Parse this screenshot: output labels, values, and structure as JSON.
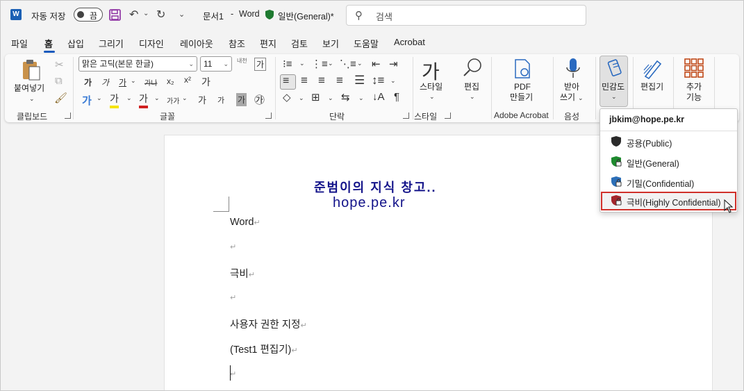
{
  "titlebar": {
    "app_letter": "W",
    "autosave_label": "자동 저장",
    "autosave_state": "끔",
    "doc_name": "문서1",
    "sep": "-",
    "app_name": "Word",
    "label_status": "일반(General)*",
    "search_placeholder": "검색"
  },
  "menu": {
    "items": [
      "파일",
      "홈",
      "삽입",
      "그리기",
      "디자인",
      "레이아웃",
      "참조",
      "편지",
      "검토",
      "보기",
      "도움말",
      "Acrobat"
    ],
    "active": "홈"
  },
  "ribbon": {
    "clipboard": {
      "paste": "붙여넣기",
      "group": "클립보드"
    },
    "font": {
      "name": "맑은 고딕(본문 한글)",
      "size": "11",
      "group": "글꼴",
      "bold": "가",
      "italic": "가",
      "underline": "가",
      "strike": "가나",
      "sub": "x₂",
      "sup": "x²",
      "clear": "가",
      "grow": "가",
      "shrink": "가",
      "case": "가가",
      "charshade": "가",
      "enclose": "㉮",
      "phonetic": "내천",
      "charborder": "가",
      "fontcolor": "가",
      "highlight": "가"
    },
    "paragraph": {
      "group": "단락"
    },
    "styles": {
      "label": "스타일",
      "group": "스타일"
    },
    "editing": {
      "label": "편집"
    },
    "acrobat": {
      "label1": "PDF",
      "label2": "만들기",
      "group": "Adobe Acrobat"
    },
    "voice": {
      "label1": "받아",
      "label2": "쓰기",
      "group": "음성"
    },
    "sensitivity": {
      "label": "민감도"
    },
    "editor": {
      "label": "편집기"
    },
    "addins": {
      "label1": "추가",
      "label2": "기능"
    }
  },
  "document": {
    "watermark_line1": "준범이의 지식 창고..",
    "watermark_line2": "hope.pe.kr",
    "lines": [
      "Word",
      "",
      "극비",
      "",
      "사용자 권한 지정",
      "(Test1 편집기)",
      ""
    ],
    "para_mark": "↵"
  },
  "sensitivity_menu": {
    "account": "jbkim@hope.pe.kr",
    "items": [
      {
        "label": "공용(Public)",
        "color": "#2b2b2b",
        "lock": false
      },
      {
        "label": "일반(General)",
        "color": "#1e8a2e",
        "lock": true
      },
      {
        "label": "기밀(Confidential)",
        "color": "#2c6fb8",
        "lock": true
      },
      {
        "label": "극비(Highly Confidential)",
        "color": "#a4262c",
        "lock": true
      }
    ],
    "highlighted_index": 3
  },
  "colors": {
    "accent": "#185abd",
    "highlight_border": "#d0302a"
  }
}
